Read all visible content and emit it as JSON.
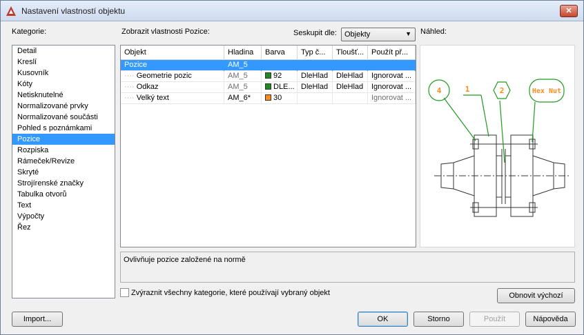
{
  "window": {
    "title": "Nastavení vlastností objektu",
    "close_glyph": "✕"
  },
  "labels": {
    "kategorie": "Kategorie:",
    "zobrazit": "Zobrazit vlastnosti Pozice:",
    "seskupit": "Seskupit dle:",
    "nahled": "Náhled:"
  },
  "group_select": {
    "value": "Objekty",
    "arrow_glyph": "▼"
  },
  "categories": [
    "Detail",
    "Kreslí",
    "Kusovník",
    "Kóty",
    "Netisknutelné",
    "Normalizované prvky",
    "Normalizované součásti",
    "Pohled s poznámkami",
    "Pozice",
    "Rozpiska",
    "Rámeček/Revize",
    "Skryté",
    "Strojírenské značky",
    "Tabulka otvorů",
    "Text",
    "Výpočty",
    "Řez"
  ],
  "selected_category": "Pozice",
  "grid": {
    "headers": [
      "Objekt",
      "Hladina",
      "Barva",
      "Typ č...",
      "Tloušť...",
      "Použít př..."
    ],
    "rows": [
      {
        "object": "Pozice",
        "layer": "AM_5",
        "color_name": "",
        "color_hex": "",
        "linetype": "",
        "lineweight": "",
        "apply": ""
      },
      {
        "object": "Geometrie pozic",
        "layer": "AM_5",
        "color_name": "92",
        "color_hex": "#1f8a1f",
        "linetype": "DleHlad",
        "lineweight": "DleHlad",
        "apply": "Ignorovat ..."
      },
      {
        "object": "Odkaz",
        "layer": "AM_5",
        "color_name": "DLE...",
        "color_hex": "#1f8a1f",
        "linetype": "DleHlad",
        "lineweight": "DleHlad",
        "apply": "Ignorovat ..."
      },
      {
        "object": "Velký text",
        "layer": "AM_6*",
        "color_name": "30",
        "color_hex": "#ff8c1a",
        "linetype": "",
        "lineweight": "",
        "apply": "Ignorovat ..."
      }
    ]
  },
  "preview": {
    "balloons": [
      "4",
      "1",
      "2",
      "Hex Nut"
    ],
    "balloon_color": "#1f9a1f",
    "text_color": "#ff8c1a",
    "line_color": "#333333"
  },
  "description": "Ovlivňuje pozice založené na normě",
  "highlight_checkbox": {
    "label": "Zvýraznit všechny kategorie, které používají vybraný objekt",
    "checked": false
  },
  "buttons": {
    "reset": "Obnovit výchozí",
    "import": "Import...",
    "ok": "OK",
    "cancel": "Storno",
    "apply": "Použít",
    "help": "Nápověda"
  }
}
